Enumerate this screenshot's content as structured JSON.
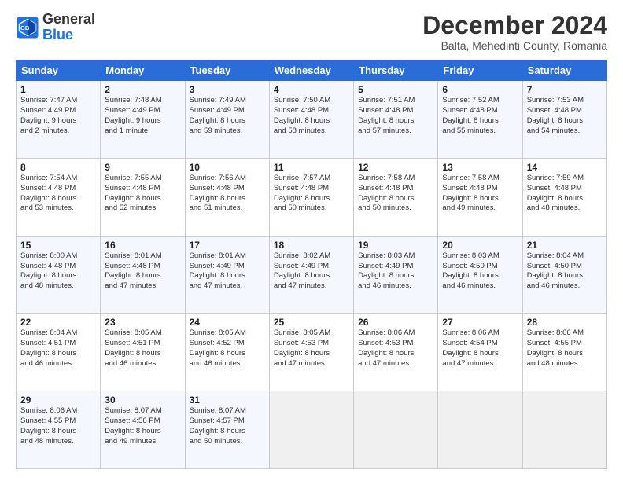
{
  "logo": {
    "line1": "General",
    "line2": "Blue"
  },
  "title": "December 2024",
  "subtitle": "Balta, Mehedinti County, Romania",
  "days_of_week": [
    "Sunday",
    "Monday",
    "Tuesday",
    "Wednesday",
    "Thursday",
    "Friday",
    "Saturday"
  ],
  "weeks": [
    [
      {
        "day": "1",
        "sunrise": "7:47 AM",
        "sunset": "4:49 PM",
        "daylight": "9 hours and 2 minutes."
      },
      {
        "day": "2",
        "sunrise": "7:48 AM",
        "sunset": "4:49 PM",
        "daylight": "9 hours and 1 minute."
      },
      {
        "day": "3",
        "sunrise": "7:49 AM",
        "sunset": "4:49 PM",
        "daylight": "8 hours and 59 minutes."
      },
      {
        "day": "4",
        "sunrise": "7:50 AM",
        "sunset": "4:48 PM",
        "daylight": "8 hours and 58 minutes."
      },
      {
        "day": "5",
        "sunrise": "7:51 AM",
        "sunset": "4:48 PM",
        "daylight": "8 hours and 57 minutes."
      },
      {
        "day": "6",
        "sunrise": "7:52 AM",
        "sunset": "4:48 PM",
        "daylight": "8 hours and 55 minutes."
      },
      {
        "day": "7",
        "sunrise": "7:53 AM",
        "sunset": "4:48 PM",
        "daylight": "8 hours and 54 minutes."
      }
    ],
    [
      {
        "day": "8",
        "sunrise": "7:54 AM",
        "sunset": "4:48 PM",
        "daylight": "8 hours and 53 minutes."
      },
      {
        "day": "9",
        "sunrise": "7:55 AM",
        "sunset": "4:48 PM",
        "daylight": "8 hours and 52 minutes."
      },
      {
        "day": "10",
        "sunrise": "7:56 AM",
        "sunset": "4:48 PM",
        "daylight": "8 hours and 51 minutes."
      },
      {
        "day": "11",
        "sunrise": "7:57 AM",
        "sunset": "4:48 PM",
        "daylight": "8 hours and 50 minutes."
      },
      {
        "day": "12",
        "sunrise": "7:58 AM",
        "sunset": "4:48 PM",
        "daylight": "8 hours and 50 minutes."
      },
      {
        "day": "13",
        "sunrise": "7:58 AM",
        "sunset": "4:48 PM",
        "daylight": "8 hours and 49 minutes."
      },
      {
        "day": "14",
        "sunrise": "7:59 AM",
        "sunset": "4:48 PM",
        "daylight": "8 hours and 48 minutes."
      }
    ],
    [
      {
        "day": "15",
        "sunrise": "8:00 AM",
        "sunset": "4:48 PM",
        "daylight": "8 hours and 48 minutes."
      },
      {
        "day": "16",
        "sunrise": "8:01 AM",
        "sunset": "4:48 PM",
        "daylight": "8 hours and 47 minutes."
      },
      {
        "day": "17",
        "sunrise": "8:01 AM",
        "sunset": "4:49 PM",
        "daylight": "8 hours and 47 minutes."
      },
      {
        "day": "18",
        "sunrise": "8:02 AM",
        "sunset": "4:49 PM",
        "daylight": "8 hours and 47 minutes."
      },
      {
        "day": "19",
        "sunrise": "8:03 AM",
        "sunset": "4:49 PM",
        "daylight": "8 hours and 46 minutes."
      },
      {
        "day": "20",
        "sunrise": "8:03 AM",
        "sunset": "4:50 PM",
        "daylight": "8 hours and 46 minutes."
      },
      {
        "day": "21",
        "sunrise": "8:04 AM",
        "sunset": "4:50 PM",
        "daylight": "8 hours and 46 minutes."
      }
    ],
    [
      {
        "day": "22",
        "sunrise": "8:04 AM",
        "sunset": "4:51 PM",
        "daylight": "8 hours and 46 minutes."
      },
      {
        "day": "23",
        "sunrise": "8:05 AM",
        "sunset": "4:51 PM",
        "daylight": "8 hours and 46 minutes."
      },
      {
        "day": "24",
        "sunrise": "8:05 AM",
        "sunset": "4:52 PM",
        "daylight": "8 hours and 46 minutes."
      },
      {
        "day": "25",
        "sunrise": "8:05 AM",
        "sunset": "4:53 PM",
        "daylight": "8 hours and 47 minutes."
      },
      {
        "day": "26",
        "sunrise": "8:06 AM",
        "sunset": "4:53 PM",
        "daylight": "8 hours and 47 minutes."
      },
      {
        "day": "27",
        "sunrise": "8:06 AM",
        "sunset": "4:54 PM",
        "daylight": "8 hours and 47 minutes."
      },
      {
        "day": "28",
        "sunrise": "8:06 AM",
        "sunset": "4:55 PM",
        "daylight": "8 hours and 48 minutes."
      }
    ],
    [
      {
        "day": "29",
        "sunrise": "8:06 AM",
        "sunset": "4:55 PM",
        "daylight": "8 hours and 48 minutes."
      },
      {
        "day": "30",
        "sunrise": "8:07 AM",
        "sunset": "4:56 PM",
        "daylight": "8 hours and 49 minutes."
      },
      {
        "day": "31",
        "sunrise": "8:07 AM",
        "sunset": "4:57 PM",
        "daylight": "8 hours and 50 minutes."
      },
      null,
      null,
      null,
      null
    ]
  ]
}
